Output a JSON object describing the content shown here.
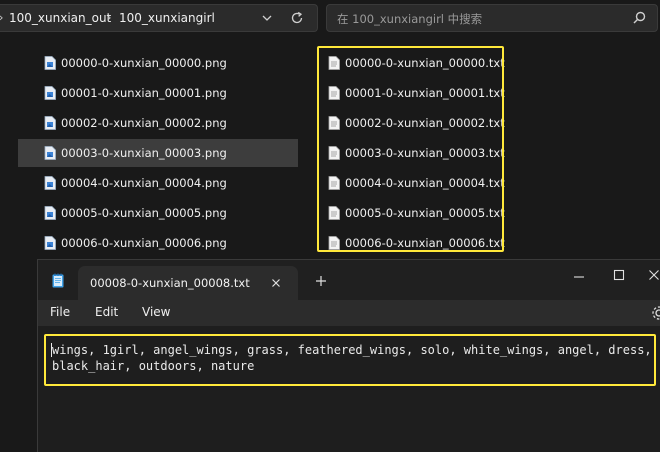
{
  "explorer": {
    "breadcrumb": [
      "100_xunxian_out",
      "100_xunxiangirl"
    ],
    "search_placeholder": "在 100_xunxiangirl 中搜索",
    "files_left": [
      "00000-0-xunxian_00000.png",
      "00001-0-xunxian_00001.png",
      "00002-0-xunxian_00002.png",
      "00003-0-xunxian_00003.png",
      "00004-0-xunxian_00004.png",
      "00005-0-xunxian_00005.png",
      "00006-0-xunxian_00006.png"
    ],
    "files_right": [
      "00000-0-xunxian_00000.txt",
      "00001-0-xunxian_00001.txt",
      "00002-0-xunxian_00002.txt",
      "00003-0-xunxian_00003.txt",
      "00004-0-xunxian_00004.txt",
      "00005-0-xunxian_00005.txt",
      "00006-0-xunxian_00006.txt"
    ],
    "selected_file": "00003-0-xunxian_00003.png"
  },
  "notepad": {
    "tab_title": "00008-0-xunxian_00008.txt",
    "menu": [
      "File",
      "Edit",
      "View"
    ],
    "content_lines": [
      "wings, 1girl, angel_wings, grass, feathered_wings, solo, white_wings, angel, dress,",
      "black_hair, outdoors, nature"
    ]
  },
  "colors": {
    "highlight": "#ffe83a",
    "selection": "#3d3d3d",
    "background": "#1c1c1c"
  },
  "icons": {
    "image_file": "image-file-icon",
    "text_file": "text-file-icon",
    "refresh": "refresh-icon",
    "search": "search-icon",
    "notepad": "notepad-icon",
    "close": "close-icon",
    "add": "plus-icon",
    "settings": "gear-icon"
  }
}
